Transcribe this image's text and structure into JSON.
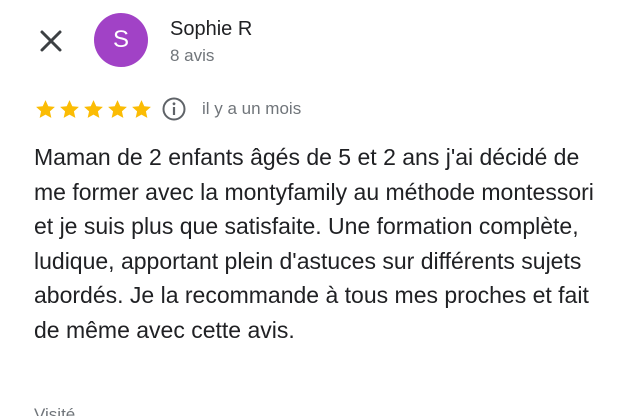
{
  "header": {
    "close_icon": "close-icon",
    "avatar_letter": "S",
    "avatar_color": "#a142c6",
    "user_name": "Sophie R",
    "review_count": "8 avis"
  },
  "review": {
    "rating": 5,
    "max_rating": 5,
    "star_color": "#fbbc04",
    "info_icon": "info-icon",
    "date": "il y a un mois",
    "text": "Maman de 2 enfants âgés de 5 et 2 ans j'ai décidé de me former avec la montyfamily au méthode montessori et je suis plus que satisfaite. Une formation complète, ludique, apportant plein d'astuces sur différents sujets abordés. Je la recommande à tous mes proches et fait de même avec cette avis.",
    "partial_next_line": "Visité"
  }
}
